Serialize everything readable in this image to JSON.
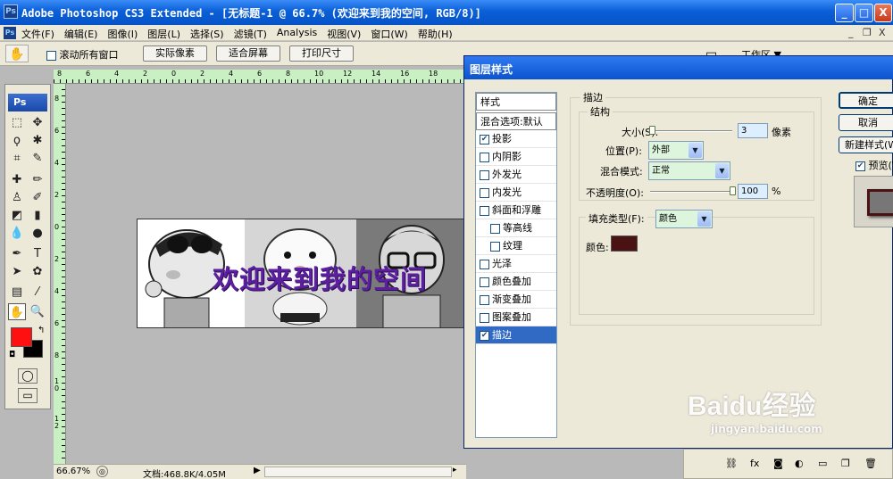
{
  "window": {
    "title": "Adobe Photoshop CS3 Extended - [无标题-1 @ 66.7% (欢迎来到我的空间, RGB/8)]",
    "logo": "Ps",
    "controls": [
      "_",
      "□",
      "X"
    ]
  },
  "menu": {
    "items": [
      "文件(F)",
      "编辑(E)",
      "图像(I)",
      "图层(L)",
      "选择(S)",
      "滤镜(T)",
      "Analysis",
      "视图(V)",
      "窗口(W)",
      "帮助(H)"
    ],
    "doc_controls": [
      "_",
      "❐",
      "X"
    ]
  },
  "options": {
    "scroll_all_label": "滚动所有窗口",
    "btn_actual": "实际像素",
    "btn_fit": "适合屏幕",
    "btn_print": "打印尺寸",
    "workspace": "工作区 ▼"
  },
  "toolbox": {
    "badge": "Ps"
  },
  "ruler_top": [
    "8",
    "6",
    "4",
    "2",
    "0",
    "2",
    "4",
    "6",
    "8",
    "10",
    "12",
    "14",
    "16",
    "18"
  ],
  "ruler_left": [
    "8",
    "6",
    "4",
    "2",
    "0",
    "2",
    "4",
    "6",
    "8",
    "1 0",
    "1 2"
  ],
  "canvas": {
    "banner_text": "欢迎来到我的空间"
  },
  "status": {
    "zoom": "66.67%",
    "doc": "文档:468.8K/4.05M"
  },
  "dialog": {
    "title": "图层样式",
    "list": [
      {
        "label": "样式",
        "type": "header"
      },
      {
        "label": "混合选项:默认",
        "type": "header"
      },
      {
        "label": "投影",
        "checked": true
      },
      {
        "label": "内阴影",
        "checked": false
      },
      {
        "label": "外发光",
        "checked": false
      },
      {
        "label": "内发光",
        "checked": false
      },
      {
        "label": "斜面和浮雕",
        "checked": false
      },
      {
        "label": "等高线",
        "checked": false,
        "indent": true
      },
      {
        "label": "纹理",
        "checked": false,
        "indent": true
      },
      {
        "label": "光泽",
        "checked": false
      },
      {
        "label": "颜色叠加",
        "checked": false
      },
      {
        "label": "渐变叠加",
        "checked": false
      },
      {
        "label": "图案叠加",
        "checked": false
      },
      {
        "label": "描边",
        "checked": true,
        "selected": true
      }
    ],
    "stroke": {
      "group_label": "描边",
      "structure_label": "结构",
      "size_label": "大小(S):",
      "size_value": "3",
      "size_unit": "像素",
      "size_fraction": 0.02,
      "position_label": "位置(P):",
      "position_value": "外部",
      "blend_label": "混合模式:",
      "blend_value": "正常",
      "opacity_label": "不透明度(O):",
      "opacity_value": "100",
      "opacity_unit": "%",
      "opacity_fraction": 1.0,
      "fill_type_label": "填充类型(F):",
      "fill_type_value": "颜色",
      "color_label": "颜色:",
      "color_hex": "#4a1212"
    },
    "buttons": {
      "ok": "确定",
      "cancel": "取消",
      "new_style": "新建样式(W)...",
      "preview": "预览(V)"
    }
  },
  "colors": {
    "foreground": "#ff1010",
    "background": "#000000",
    "selection": "#316ac5",
    "title_bar": "#0a5fd8"
  },
  "watermark": {
    "text": "Baidu经验",
    "sub": "jingyan.baidu.com"
  }
}
